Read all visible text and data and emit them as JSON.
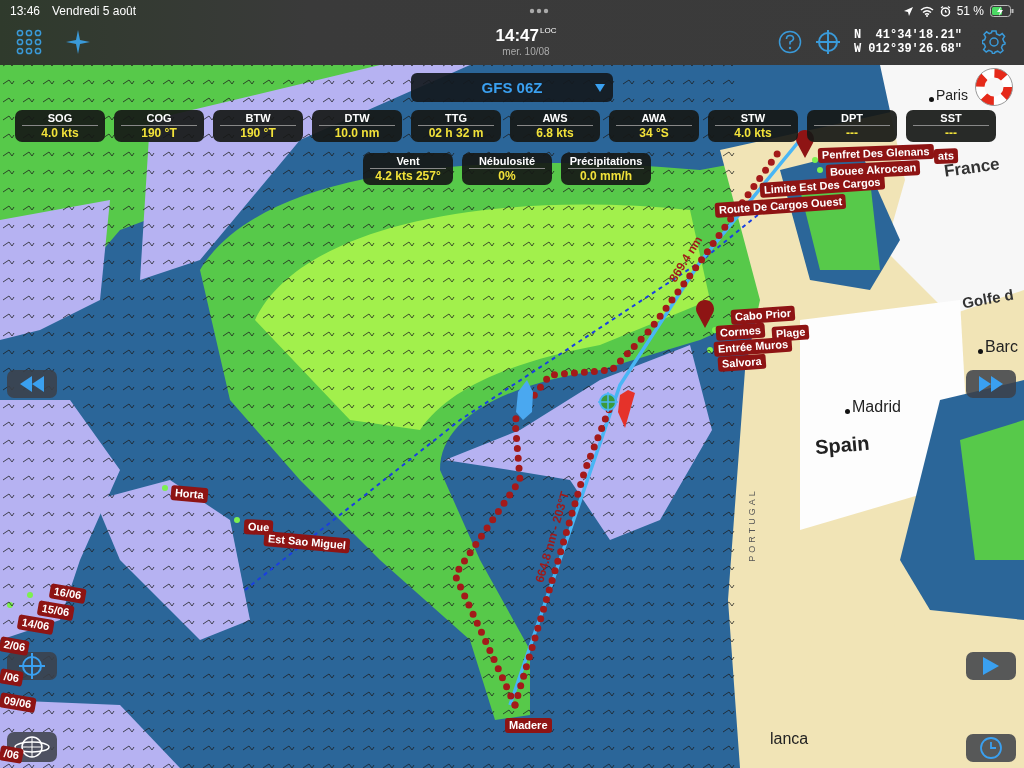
{
  "status_bar": {
    "time": "13:46",
    "date": "Vendredi 5 août",
    "battery": "51 %"
  },
  "toolbar": {
    "clock": "14:47",
    "clock_suffix": "LOC",
    "date": "mer. 10/08",
    "latitude": "N  41°34'18.21\"",
    "longitude": "W 012°39'26.68\""
  },
  "grib_model": {
    "label": "GFS 06Z"
  },
  "instruments": [
    {
      "label": "SOG",
      "value": "4.0 kts"
    },
    {
      "label": "COG",
      "value": "190 °T"
    },
    {
      "label": "BTW",
      "value": "190 °T"
    },
    {
      "label": "DTW",
      "value": "10.0 nm"
    },
    {
      "label": "TTG",
      "value": "02 h 32 m"
    },
    {
      "label": "AWS",
      "value": "6.8 kts"
    },
    {
      "label": "AWA",
      "value": "34 °S"
    },
    {
      "label": "STW",
      "value": "4.0 kts"
    },
    {
      "label": "DPT",
      "value": "---"
    },
    {
      "label": "SST",
      "value": "---"
    }
  ],
  "weather": [
    {
      "label": "Vent",
      "value": "4.2 kts 257°"
    },
    {
      "label": "Nébulosité",
      "value": "0%"
    },
    {
      "label": "Précipitations",
      "value": "0.0 mm/h"
    }
  ],
  "map": {
    "places": [
      {
        "name": "Paris",
        "city": true
      },
      {
        "name": "France",
        "city": false
      },
      {
        "name": "Golfe d",
        "city": false
      },
      {
        "name": "Barc",
        "city": true
      },
      {
        "name": "Madrid",
        "city": true
      },
      {
        "name": "Spain",
        "city": false
      },
      {
        "name": "PORTUGAL",
        "city": false
      },
      {
        "name": "lanca",
        "city": false
      }
    ],
    "waypoints": [
      "ats",
      "Penfret Des Glenans",
      "Bouee Akrocean",
      "Limite Est Des Cargos",
      "Route De Cargos Ouest",
      "Cabo Prior",
      "Cormes",
      "Plage",
      "Entrée Muros",
      "Salvora",
      "Horta",
      "Oue",
      "Est Sao Miguel",
      "Madere"
    ],
    "date_marks": [
      "16/06",
      "15/06",
      "14/06",
      "2/06",
      "/06",
      "09/06",
      "/06"
    ],
    "route_labels": [
      "869.4 nm",
      "664.8 nm - 203°T"
    ]
  }
}
